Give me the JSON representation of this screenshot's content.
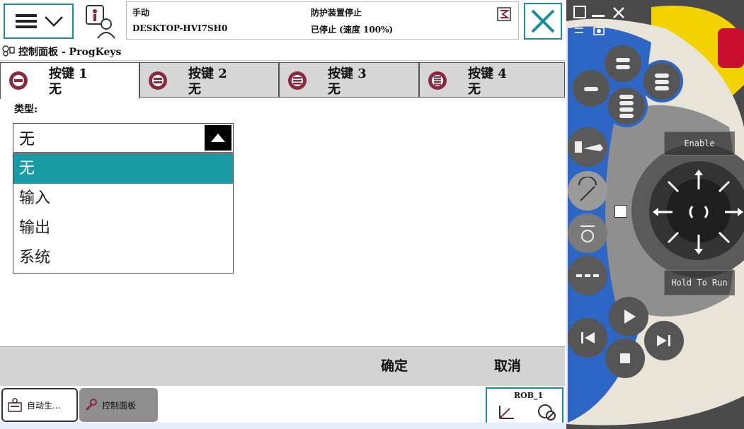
{
  "header": {
    "mode": "手动",
    "host": "DESKTOP-HVI7SH0",
    "safety": "防护装置停止",
    "state": "已停止 (速度 100%)"
  },
  "title": "控制面板 - ProgKeys",
  "tabs": [
    {
      "name": "按键 1",
      "value": "无"
    },
    {
      "name": "按键 2",
      "value": "无"
    },
    {
      "name": "按键 3",
      "value": "无"
    },
    {
      "name": "按键 4",
      "value": "无"
    }
  ],
  "type_label": "类型:",
  "combo": {
    "value": "无",
    "options": [
      "无",
      "输入",
      "输出",
      "系统"
    ]
  },
  "commands": {
    "ok": "确定",
    "cancel": "取消"
  },
  "taskbar": {
    "task1": "自动生...",
    "task2": "控制面板",
    "robot": "ROB_1"
  },
  "pendant": {
    "enable": "Enable",
    "hold": "Hold To Run"
  },
  "colors": {
    "accent": "#1a9aa4",
    "frame": "#1a8f9c"
  }
}
